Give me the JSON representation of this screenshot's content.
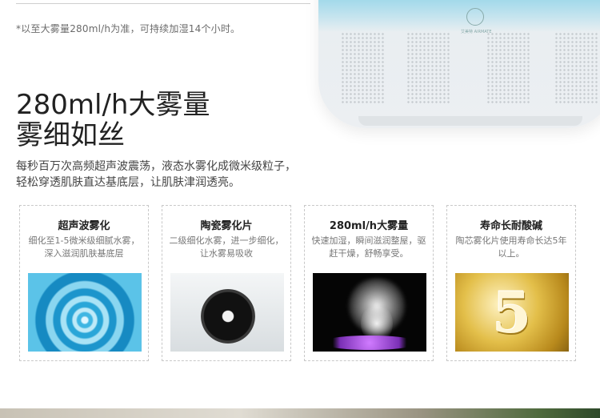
{
  "footnote": "*以至大雾量280ml/h为准，可持续加湿14个小时。",
  "headline": {
    "line1": "280ml/h大雾量",
    "line2": "雾细如丝"
  },
  "description": {
    "line1": "每秒百万次高频超声波震荡，液态水雾化成微米级粒子，",
    "line2": "轻松穿透肌肤直达基底层，让肌肤津润透亮。"
  },
  "product": {
    "brand": "艾美特 AIRMATE"
  },
  "cards": [
    {
      "title": "超声波雾化",
      "text": "细化至1-5微米级细腻水雾，深入滋润肌肤基底层",
      "image_icon": "water-ripple-image"
    },
    {
      "title": "陶瓷雾化片",
      "text": "二级细化水雾，进一步细化，让水雾易吸收",
      "image_icon": "ceramic-disc-image"
    },
    {
      "title": "280ml/h大雾量",
      "text": "快速加湿，瞬间滋润整屋，驱赶干燥，舒畅享受。",
      "image_icon": "mist-image"
    },
    {
      "title": "寿命长耐酸碱",
      "text": "陶芯雾化片使用寿命长达5年以上。",
      "image_icon": "gold-medal-image",
      "badge": "5"
    }
  ]
}
